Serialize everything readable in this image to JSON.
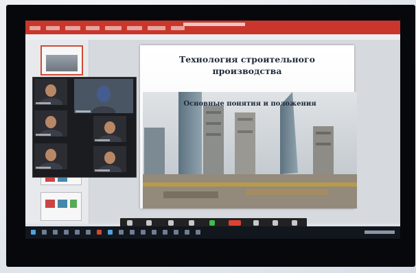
{
  "slide": {
    "title": "Технология строительного производства",
    "subtitle": "Основные понятия и положения"
  },
  "colors": {
    "ribbon": "#c9372c",
    "taskbar": "#12161d",
    "zoom_green": "#3fbf4a",
    "zoom_red": "#e04134"
  },
  "icons": {
    "zoom_controls": [
      "mute-icon",
      "video-icon",
      "security-icon",
      "participants-icon",
      "chat-icon",
      "share-screen-icon",
      "record-icon",
      "reactions-icon",
      "end-meeting-icon"
    ],
    "taskbar": [
      "windows-start-icon",
      "search-icon",
      "task-view-icon",
      "explorer-icon",
      "browser-icon",
      "mail-icon",
      "powerpoint-icon",
      "zoom-icon",
      "store-icon"
    ]
  }
}
